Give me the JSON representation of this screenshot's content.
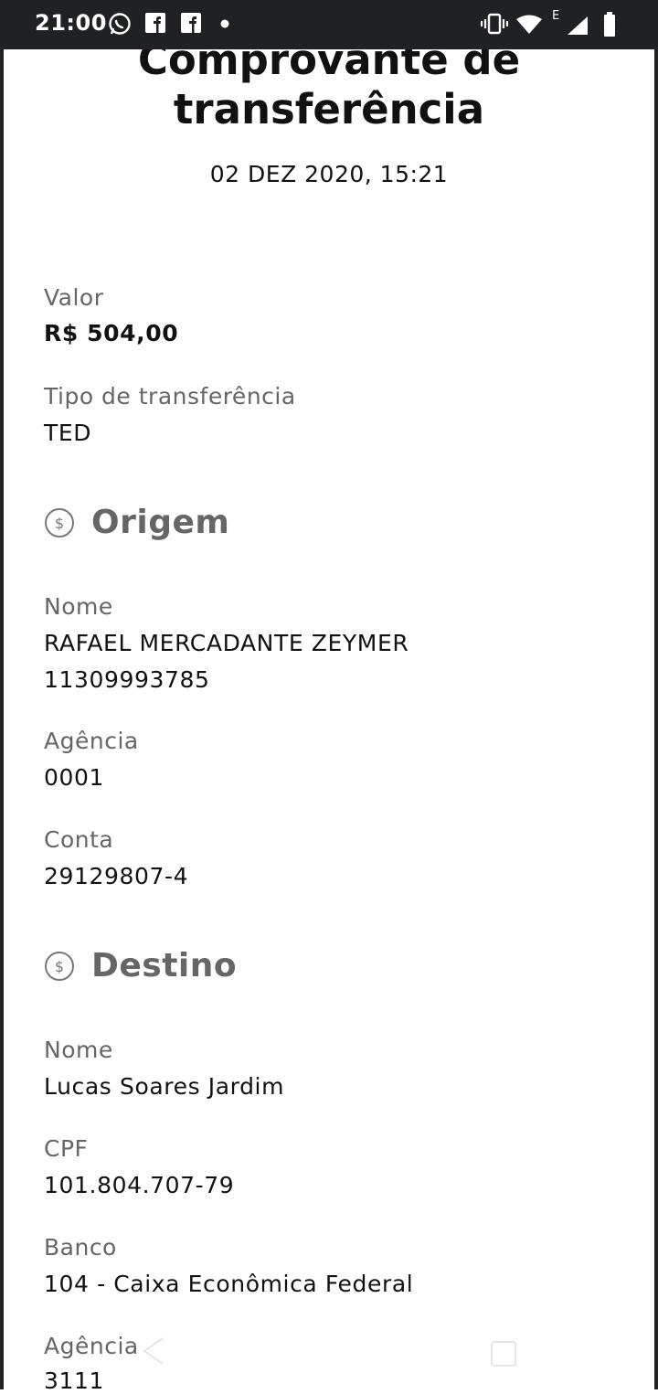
{
  "status_bar": {
    "time": "21:00",
    "network_label": "E",
    "icons": [
      "whatsapp-icon",
      "facebook-icon",
      "facebook-icon",
      "dot-icon",
      "vibrate-icon",
      "wifi-icon",
      "signal-icon",
      "battery-icon"
    ]
  },
  "receipt": {
    "title_line1": "Comprovante de",
    "title_line2": "transferência",
    "datetime": "02 DEZ 2020, 15:21",
    "valor_label": "Valor",
    "valor_value": "R$ 504,00",
    "tipo_label": "Tipo de transferência",
    "tipo_value": "TED"
  },
  "origem": {
    "section_title": "Origem",
    "nome_label": "Nome",
    "nome_value": "RAFAEL MERCADANTE ZEYMER",
    "nome_id": "11309993785",
    "agencia_label": "Agência",
    "agencia_value": "0001",
    "conta_label": "Conta",
    "conta_value": "29129807-4"
  },
  "destino": {
    "section_title": "Destino",
    "nome_label": "Nome",
    "nome_value": "Lucas Soares Jardim",
    "cpf_label": "CPF",
    "cpf_value": "101.804.707-79",
    "banco_label": "Banco",
    "banco_value": "104 - Caixa Econômica Federal",
    "agencia_label": "Agência",
    "agencia_value": "3111"
  },
  "colors": {
    "status_bar_bg": "#202124",
    "label_gray": "#666666",
    "text_dark": "#111111",
    "background": "#ffffff"
  }
}
